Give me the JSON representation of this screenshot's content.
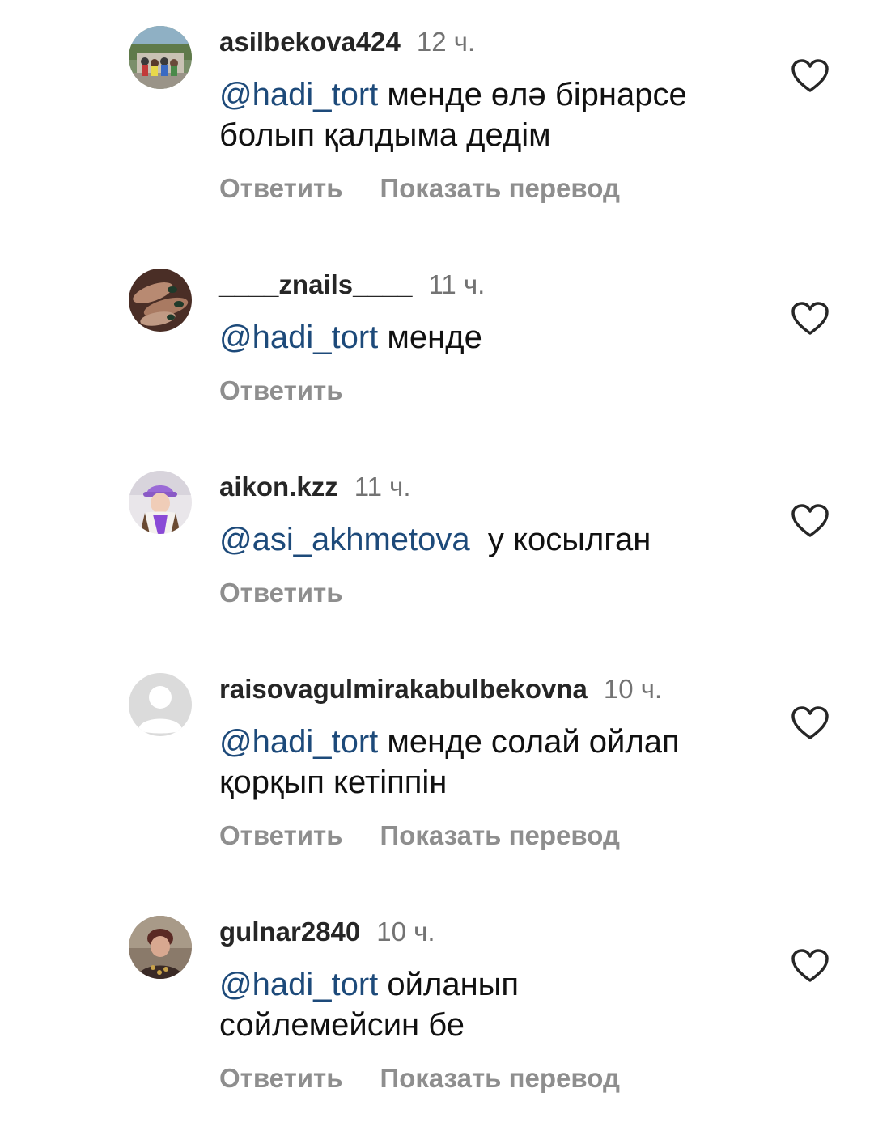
{
  "comments": [
    {
      "username": "asilbekova424",
      "time": "12 ч.",
      "mention": "@hadi_tort",
      "text": " менде өлә бірнарсе болып қалдыма дедім",
      "reply": "Ответить",
      "translate": "Показать перевод"
    },
    {
      "username": "____znails____",
      "time": "11 ч.",
      "mention": "@hadi_tort",
      "text": " менде",
      "reply": "Ответить"
    },
    {
      "username": "aikon.kzz",
      "time": "11 ч.",
      "mention": "@asi_akhmetova",
      "text": "  у косылган",
      "reply": "Ответить"
    },
    {
      "username": "raisovagulmirakabulbekovna",
      "time": "10 ч.",
      "mention": "@hadi_tort",
      "text": " менде солай ойлап қорқып кетіппін",
      "reply": "Ответить",
      "translate": "Показать перевод"
    },
    {
      "username": "gulnar2840",
      "time": "10 ч.",
      "mention": "@hadi_tort",
      "text": " ойланып сойлемейсин бе",
      "reply": "Ответить",
      "translate": "Показать перевод"
    }
  ],
  "icons": {
    "like": "heart-outline-icon",
    "default_avatar": "default-avatar-icon"
  },
  "colors": {
    "mention": "#1d4a7a",
    "username": "#262626",
    "secondary": "#8e8e8e"
  }
}
